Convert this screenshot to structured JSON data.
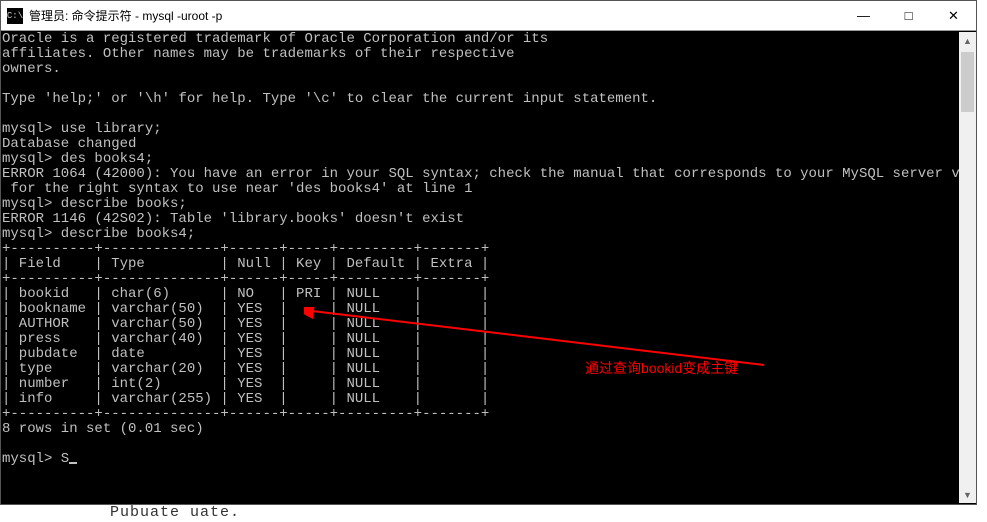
{
  "titlebar": {
    "icon_text": "C:\\",
    "title": "管理员: 命令提示符 - mysql  -uroot -p"
  },
  "window_controls": {
    "minimize": "—",
    "maximize": "□",
    "close": "✕"
  },
  "terminal": {
    "intro": "Oracle is a registered trademark of Oracle Corporation and/or its\naffiliates. Other names may be trademarks of their respective\nowners.\n\nType 'help;' or '\\h' for help. Type '\\c' to clear the current input statement.\n",
    "prompt1": "mysql> use library;",
    "db_changed": "Database changed",
    "prompt2": "mysql> des books4;",
    "error1": "ERROR 1064 (42000): You have an error in your SQL syntax; check the manual that corresponds to your MySQL server version\n for the right syntax to use near 'des books4' at line 1",
    "prompt3": "mysql> describe books;",
    "error2": "ERROR 1146 (42S02): Table 'library.books' doesn't exist",
    "prompt4": "mysql> describe books4;",
    "table_top": "+----------+--------------+------+-----+---------+-------+",
    "table_header": "| Field    | Type         | Null | Key | Default | Extra |",
    "table_sep": "+----------+--------------+------+-----+---------+-------+",
    "rows": [
      "| bookid   | char(6)      | NO   | PRI | NULL    |       |",
      "| bookname | varchar(50)  | YES  |     | NULL    |       |",
      "| AUTHOR   | varchar(50)  | YES  |     | NULL    |       |",
      "| press    | varchar(40)  | YES  |     | NULL    |       |",
      "| pubdate  | date         | YES  |     | NULL    |       |",
      "| type     | varchar(20)  | YES  |     | NULL    |       |",
      "| number   | int(2)       | YES  |     | NULL    |       |",
      "| info     | varchar(255) | YES  |     | NULL    |       |"
    ],
    "table_bottom": "+----------+--------------+------+-----+---------+-------+",
    "rows_msg": "8 rows in set (0.01 sec)",
    "prompt5": "mysql> S"
  },
  "chart_data": {
    "type": "table",
    "title": "describe books4",
    "columns": [
      "Field",
      "Type",
      "Null",
      "Key",
      "Default",
      "Extra"
    ],
    "rows": [
      {
        "Field": "bookid",
        "Type": "char(6)",
        "Null": "NO",
        "Key": "PRI",
        "Default": "NULL",
        "Extra": ""
      },
      {
        "Field": "bookname",
        "Type": "varchar(50)",
        "Null": "YES",
        "Key": "",
        "Default": "NULL",
        "Extra": ""
      },
      {
        "Field": "AUTHOR",
        "Type": "varchar(50)",
        "Null": "YES",
        "Key": "",
        "Default": "NULL",
        "Extra": ""
      },
      {
        "Field": "press",
        "Type": "varchar(40)",
        "Null": "YES",
        "Key": "",
        "Default": "NULL",
        "Extra": ""
      },
      {
        "Field": "pubdate",
        "Type": "date",
        "Null": "YES",
        "Key": "",
        "Default": "NULL",
        "Extra": ""
      },
      {
        "Field": "type",
        "Type": "varchar(20)",
        "Null": "YES",
        "Key": "",
        "Default": "NULL",
        "Extra": ""
      },
      {
        "Field": "number",
        "Type": "int(2)",
        "Null": "YES",
        "Key": "",
        "Default": "NULL",
        "Extra": ""
      },
      {
        "Field": "info",
        "Type": "varchar(255)",
        "Null": "YES",
        "Key": "",
        "Default": "NULL",
        "Extra": ""
      }
    ]
  },
  "annotation": {
    "text": "通过查询bookid变成主键"
  },
  "bottom_partial": "Pubuate uate."
}
